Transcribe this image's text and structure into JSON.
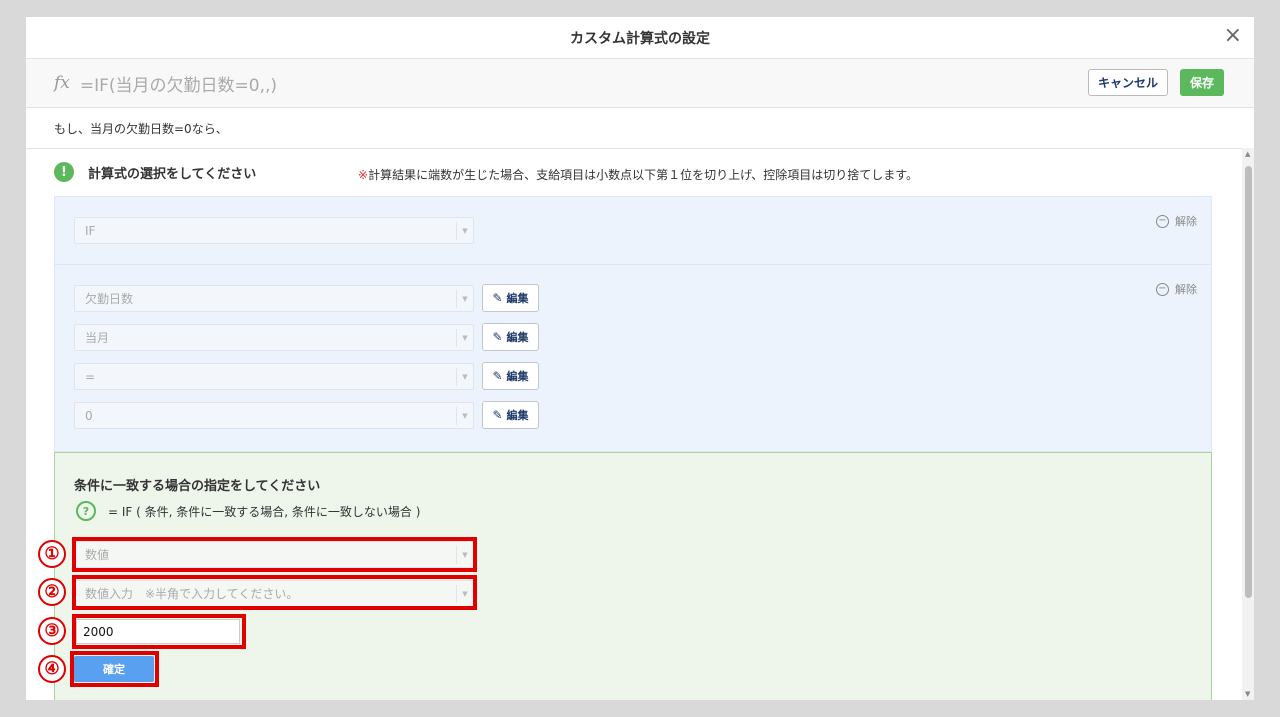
{
  "dialog": {
    "title": "カスタム計算式の設定",
    "close_icon": "×",
    "formula_prefix": "fx",
    "formula": "=IF(当月の欠勤日数=0,,)",
    "cancel_label": "キャンセル",
    "save_label": "保存",
    "description": "もし、当月の欠勤日数=0なら、"
  },
  "section": {
    "title": "計算式の選択をしてください",
    "note_mark": "※",
    "note": "計算結果に端数が生じた場合、支給項目は小数点以下第１位を切り上げ、控除項目は切り捨てします。"
  },
  "panel1": {
    "remove_label": "解除",
    "function_select": "IF"
  },
  "panel2": {
    "remove_label": "解除",
    "edit_label": "編集",
    "fields": [
      "欠勤日数",
      "当月",
      "=",
      "0"
    ]
  },
  "condition": {
    "title": "条件に一致する場合の指定をしてください",
    "help": "= IF ( 条件, 条件に一致する場合, 条件に一致しない場合 )",
    "type_select": "数値",
    "value_placeholder": "数値入力　※半角で入力してください。",
    "value": "2000",
    "confirm_label": "確定"
  },
  "annotations": [
    "①",
    "②",
    "③",
    "④"
  ],
  "colors": {
    "accent_green": "#5cb85c",
    "confirm_blue": "#5aa0f0",
    "highlight_red": "#e00000"
  }
}
